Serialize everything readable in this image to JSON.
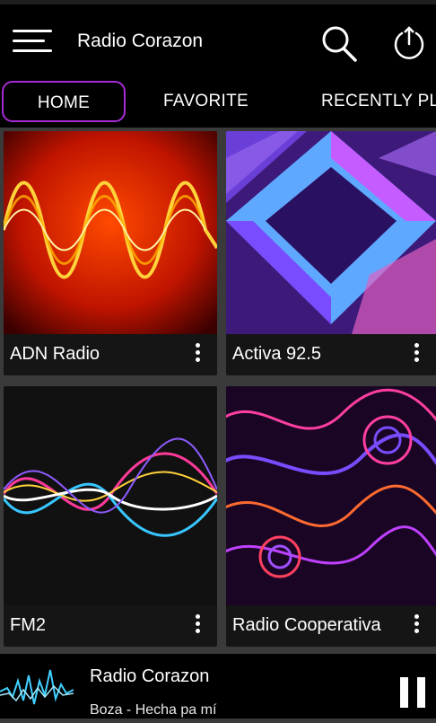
{
  "header": {
    "title": "Radio Corazon"
  },
  "tabs": [
    {
      "label": "HOME"
    },
    {
      "label": "FAVORITE"
    },
    {
      "label": "RECENTLY PL"
    }
  ],
  "stations": [
    {
      "name": "ADN Radio"
    },
    {
      "name": "Activa 92.5"
    },
    {
      "name": "FM2"
    },
    {
      "name": "Radio Cooperativa"
    }
  ],
  "player": {
    "station": "Radio Corazon",
    "track": "Boza - Hecha pa mí"
  },
  "colors": {
    "accent": "#a62bd6",
    "background": "#3a3a3a",
    "bar": "#000000"
  }
}
